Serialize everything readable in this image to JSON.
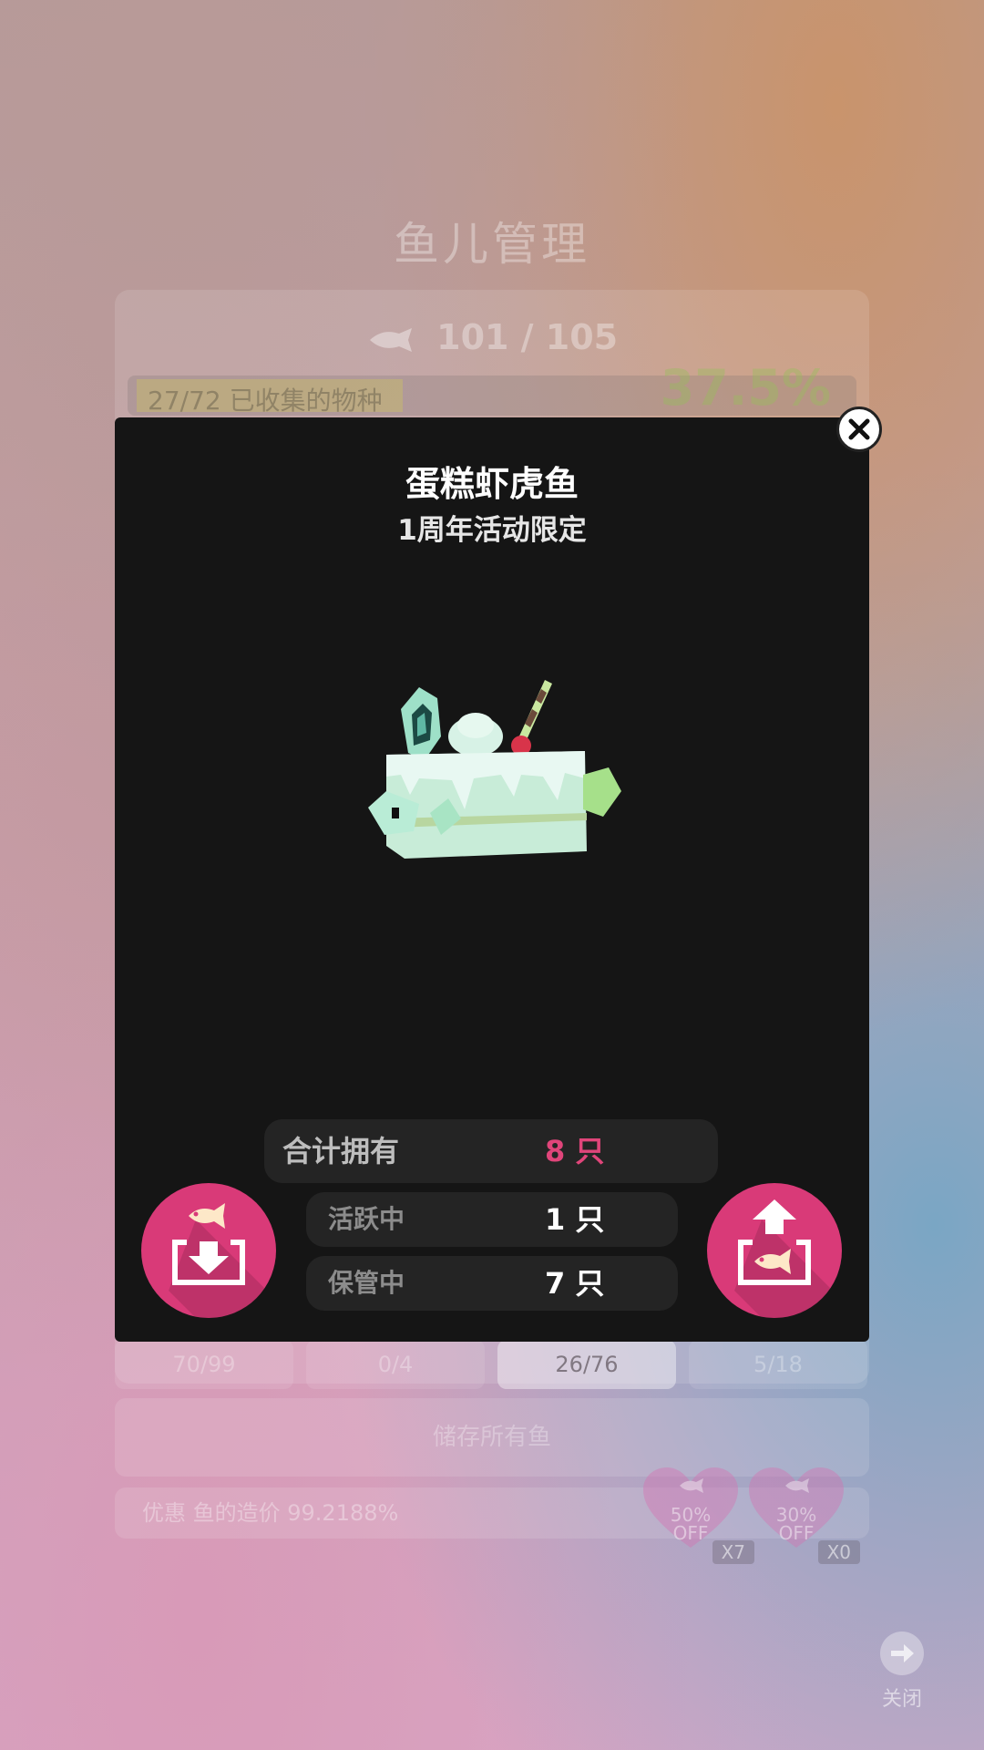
{
  "background": {
    "title": "鱼儿管理",
    "fish_count": "101 / 105",
    "progress_text": "27/72 已收集的物种",
    "progress_percent": "37.5%",
    "tabs": [
      {
        "label": "70/99"
      },
      {
        "label": "0/4"
      },
      {
        "label": "26/76"
      },
      {
        "label": "5/18"
      }
    ],
    "store_all_label": "储存所有鱼",
    "discount_text": "优惠 鱼的造价 99.2188%",
    "coupons": [
      {
        "label": "50%\nOFF",
        "multiplier": "X7"
      },
      {
        "label": "30%\nOFF",
        "multiplier": "X0"
      }
    ],
    "close_label": "关闭"
  },
  "modal": {
    "fish_name": "蛋糕虾虎鱼",
    "subtitle": "1周年活动限定",
    "total_label": "合计拥有",
    "total_value": "8 只",
    "active_label": "活跃中",
    "active_value": "1 只",
    "stored_label": "保管中",
    "stored_value": "7 只"
  },
  "colors": {
    "accent": "#d93a78",
    "total_value_color": "#e0457a",
    "modal_bg": "#151515"
  }
}
